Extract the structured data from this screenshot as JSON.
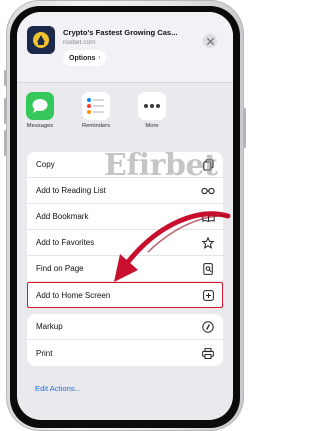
{
  "header": {
    "title": "Crypto's Fastest Growing Cas...",
    "domain": "roobet.com",
    "options_label": "Options",
    "options_chevron": "›"
  },
  "share_apps": [
    {
      "label": "Messages",
      "icon": "messages-icon",
      "color": "#34c759"
    },
    {
      "label": "Reminders",
      "icon": "reminders-icon",
      "color": "#ffffff"
    },
    {
      "label": "More",
      "icon": "more-icon",
      "color": "#ffffff"
    }
  ],
  "group1": [
    {
      "label": "Copy",
      "icon": "copy-icon"
    },
    {
      "label": "Add to Reading List",
      "icon": "glasses-icon"
    },
    {
      "label": "Add Bookmark",
      "icon": "book-icon"
    },
    {
      "label": "Add to Favorites",
      "icon": "star-icon"
    },
    {
      "label": "Find on Page",
      "icon": "find-doc-icon"
    },
    {
      "label": "Add to Home Screen",
      "icon": "plus-square-icon",
      "highlighted": true
    }
  ],
  "group2": [
    {
      "label": "Markup",
      "icon": "markup-icon"
    },
    {
      "label": "Print",
      "icon": "printer-icon"
    }
  ],
  "edit_actions_label": "Edit Actions...",
  "watermark_text": "Efirbet",
  "colors": {
    "highlight": "#d9152b",
    "arrow": "#c8102e",
    "link": "#1d6ee6"
  }
}
